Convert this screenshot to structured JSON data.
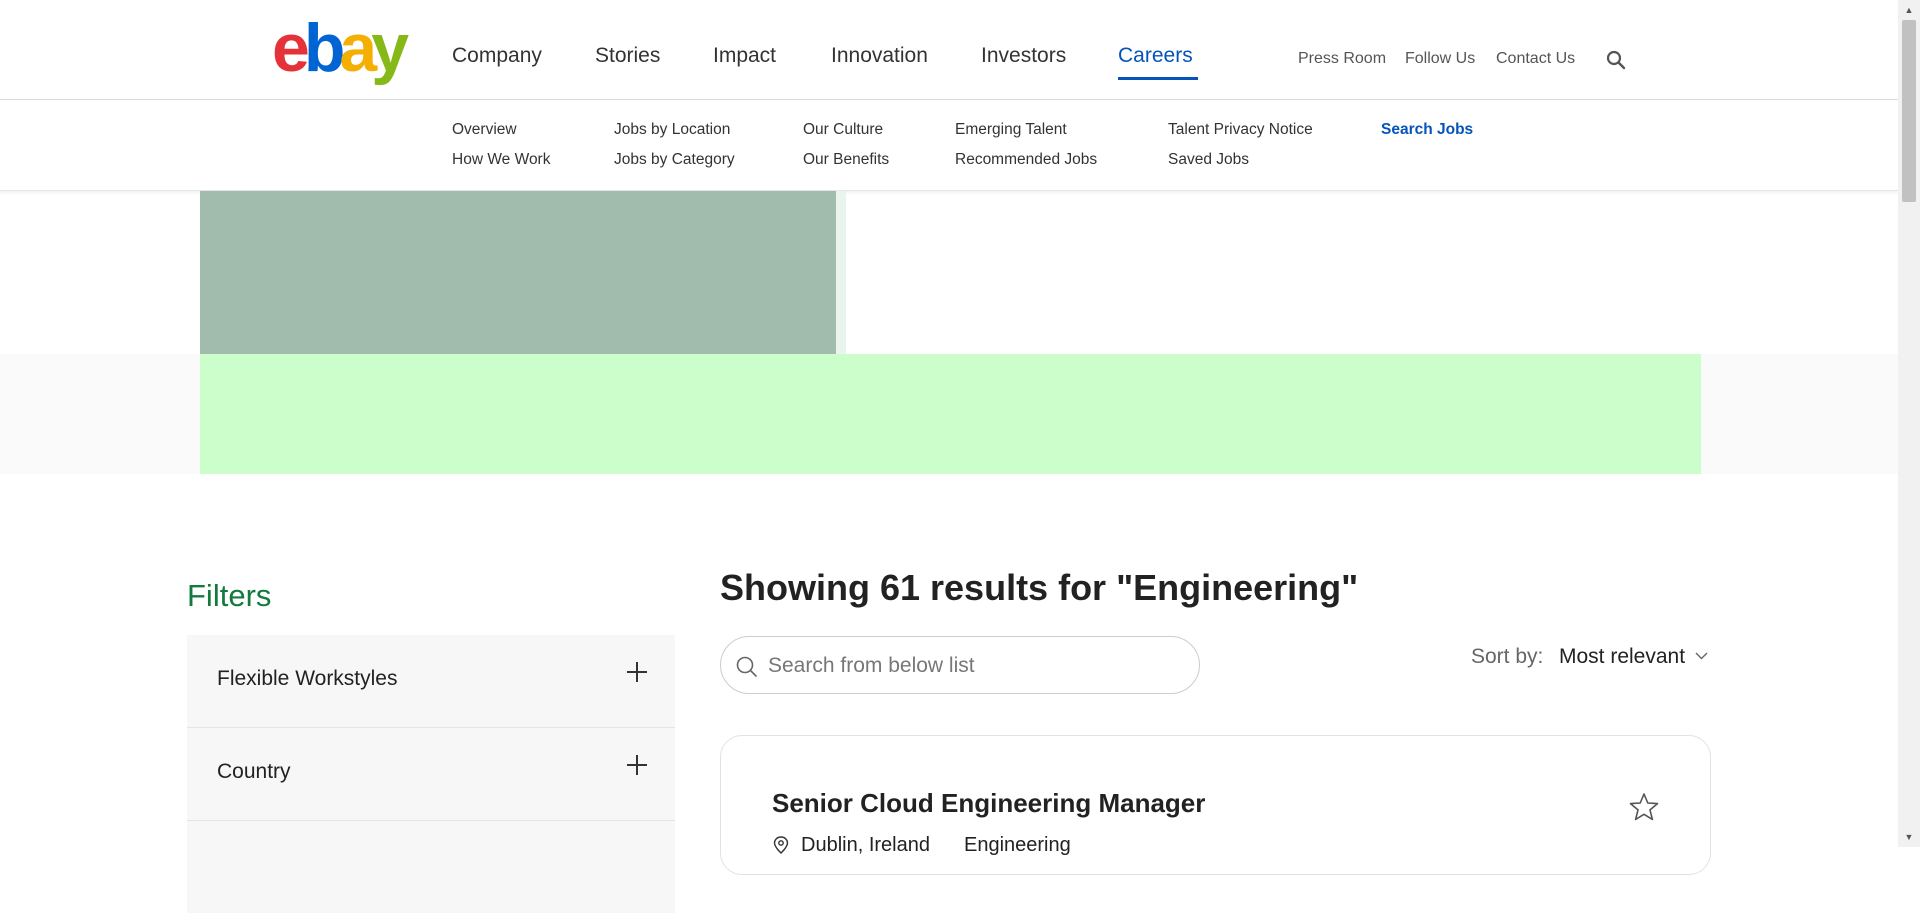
{
  "brand": {
    "logo_letters": [
      "e",
      "b",
      "a",
      "y"
    ],
    "colors": {
      "e": "#e53238",
      "b": "#0064d2",
      "a": "#f5af02",
      "y": "#86b817"
    }
  },
  "main_nav": [
    {
      "label": "Company"
    },
    {
      "label": "Stories"
    },
    {
      "label": "Impact"
    },
    {
      "label": "Innovation"
    },
    {
      "label": "Investors"
    },
    {
      "label": "Careers",
      "active": true
    }
  ],
  "util_nav": [
    {
      "label": "Press Room"
    },
    {
      "label": "Follow Us"
    },
    {
      "label": "Contact Us"
    }
  ],
  "sub_nav": {
    "col1": [
      "Overview",
      "How We Work"
    ],
    "col2": [
      "Jobs by Location",
      "Jobs by Category"
    ],
    "col3": [
      "Our Culture",
      "Our Benefits"
    ],
    "col4": [
      "Emerging Talent",
      "Recommended Jobs"
    ],
    "col5": [
      "Talent Privacy Notice",
      "Saved Jobs"
    ],
    "col6": [
      "Search Jobs"
    ]
  },
  "filters": {
    "title": "Filters",
    "items": [
      {
        "label": "Flexible Workstyles"
      },
      {
        "label": "Country"
      }
    ]
  },
  "results": {
    "heading": "Showing 61 results for \"Engineering\"",
    "search_placeholder": "Search from below list",
    "sort_label": "Sort by:",
    "sort_value": "Most relevant"
  },
  "jobs": [
    {
      "title": "Senior Cloud Engineering Manager",
      "location": "Dublin, Ireland",
      "category": "Engineering"
    }
  ],
  "colors": {
    "accent": "#0654ba",
    "filters_title": "#137a3e",
    "hero_green": "#ccfecc",
    "hero_image": "#a1bcad"
  }
}
